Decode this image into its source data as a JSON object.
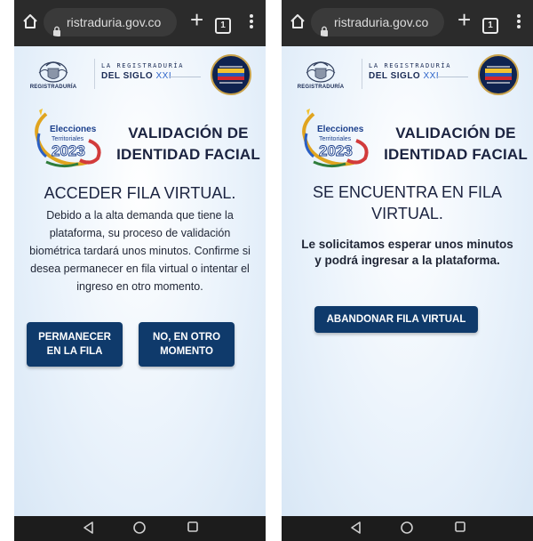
{
  "browser": {
    "url": "ristraduria.gov.co",
    "tab_count": "1"
  },
  "header": {
    "seal_caption": "REGISTRADURÍA",
    "registraduria_line1": "LA REGISTRADURÍA",
    "registraduria_line2": "DEL SIGLO",
    "registraduria_xxi": "XXI"
  },
  "elections_logo": {
    "line1": "Elecciones",
    "line2": "Territoriales",
    "year": "2023"
  },
  "page_title": "VALIDACIÓN DE IDENTIDAD FACIAL",
  "screen_left": {
    "heading": "ACCEDER FILA VIRTUAL.",
    "body": "Debido a la alta demanda que tiene la plataforma, su proceso de validación biométrica tardará unos minutos. Confirme si desea permanecer en fila virtual o intentar el ingreso en otro momento.",
    "stay_button": "PERMANECER EN LA FILA",
    "later_button": "NO, EN OTRO MOMENTO"
  },
  "screen_right": {
    "heading": "SE ENCUENTRA EN FILA VIRTUAL.",
    "body": "Le solicitamos esperar unos minutos y podrá ingresar a la plataforma.",
    "abandon_button": "ABANDONAR FILA VIRTUAL"
  },
  "icons": {
    "home": "home-icon",
    "lock": "lock-icon",
    "new_tab": "plus-icon",
    "tabs": "tab-switcher-icon",
    "menu": "more-vertical-icon",
    "nav_back": "triangle-back-icon",
    "nav_home": "circle-home-icon",
    "nav_recent": "square-recent-icon"
  },
  "colors": {
    "button_bg": "#0f3a6b",
    "title_text": "#1b2340",
    "chrome_bg": "#2b2b2b",
    "badge_bg": "#0f2350"
  }
}
